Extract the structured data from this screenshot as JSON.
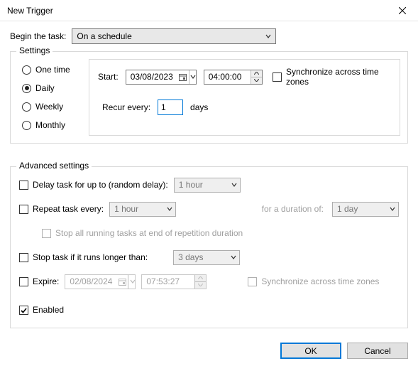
{
  "window": {
    "title": "New Trigger"
  },
  "begin": {
    "label": "Begin the task:",
    "value": "On a schedule"
  },
  "settings": {
    "legend": "Settings",
    "radios": {
      "one_time": "One time",
      "daily": "Daily",
      "weekly": "Weekly",
      "monthly": "Monthly",
      "selected": "daily"
    },
    "start_label": "Start:",
    "start_date": "03/08/2023",
    "start_time": "04:00:00",
    "sync_tz_label": "Synchronize across time zones",
    "sync_tz_checked": false,
    "recur_label": "Recur every:",
    "recur_value": "1",
    "recur_unit": "days"
  },
  "advanced": {
    "legend": "Advanced settings",
    "delay": {
      "label": "Delay task for up to (random delay):",
      "value": "1 hour",
      "checked": false
    },
    "repeat": {
      "label": "Repeat task every:",
      "value": "1 hour",
      "checked": false,
      "duration_label": "for a duration of:",
      "duration_value": "1 day"
    },
    "stop_all": {
      "label": "Stop all running tasks at end of repetition duration",
      "checked": false
    },
    "stop_if": {
      "label": "Stop task if it runs longer than:",
      "value": "3 days",
      "checked": false
    },
    "expire": {
      "label": "Expire:",
      "date": "02/08/2024",
      "time": "07:53:27",
      "checked": false,
      "sync_label": "Synchronize across time zones",
      "sync_checked": false
    },
    "enabled": {
      "label": "Enabled",
      "checked": true
    }
  },
  "buttons": {
    "ok": "OK",
    "cancel": "Cancel"
  }
}
